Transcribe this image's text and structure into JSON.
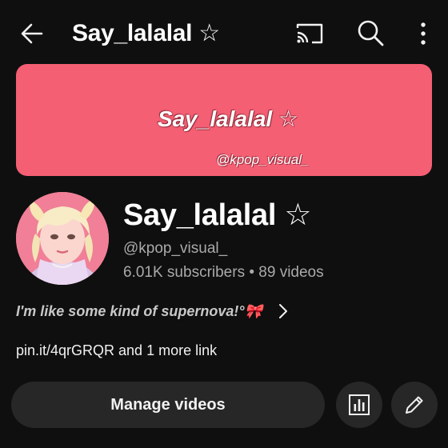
{
  "header": {
    "title": "Say_lalalal ☆",
    "icons": [
      "back-arrow-icon",
      "cast-icon",
      "search-icon",
      "more-vertical-icon"
    ]
  },
  "banner": {
    "name": "Say_lalalal ☆",
    "handle": "@kpop_visual_",
    "color": "#f45f74"
  },
  "channel": {
    "name": "Say_lalalal ☆",
    "handle": "@kpop_visual_",
    "stats": "6.01K subscribers • 89 videos",
    "description": "I'm like some kind of supernova!°🎀",
    "links": "pin.it/4qrGRQR and 1 more link"
  },
  "actions": {
    "manage_label": "Manage videos",
    "icons": [
      "analytics-icon",
      "edit-pencil-icon"
    ]
  },
  "colors": {
    "background": "#0f0f0f",
    "button": "#272727",
    "secondary_text": "#aaaaaa"
  }
}
